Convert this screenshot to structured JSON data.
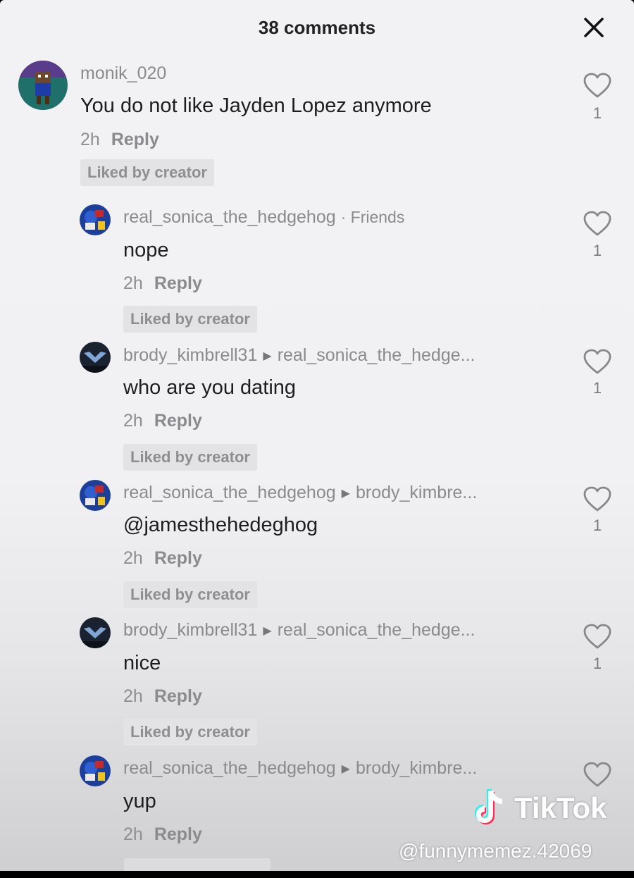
{
  "header": {
    "title": "38 comments"
  },
  "comments": [
    {
      "user": "monik_020",
      "target": "",
      "tag": "",
      "text": "You do not like Jayden Lopez anymore",
      "time": "2h",
      "reply": "Reply",
      "badge": "Liked by creator",
      "likes": "1"
    },
    {
      "user": "real_sonica_the_hedgehog",
      "target": "",
      "tag": "· Friends",
      "text": "nope",
      "time": "2h",
      "reply": "Reply",
      "badge": "Liked by creator",
      "likes": "1"
    },
    {
      "user": "brody_kimbrell31",
      "target": "real_sonica_the_hedge...",
      "tag": "",
      "text": "who are you dating",
      "time": "2h",
      "reply": "Reply",
      "badge": "Liked by creator",
      "likes": "1"
    },
    {
      "user": "real_sonica_the_hedgehog",
      "target": "brody_kimbre...",
      "tag": "",
      "text": "@jamesthehedeghog",
      "time": "2h",
      "reply": "Reply",
      "badge": "Liked by creator",
      "likes": "1"
    },
    {
      "user": "brody_kimbrell31",
      "target": "real_sonica_the_hedge...",
      "tag": "",
      "text": "nice",
      "time": "2h",
      "reply": "Reply",
      "badge": "Liked by creator",
      "likes": "1"
    },
    {
      "user": "real_sonica_the_hedgehog",
      "target": "brody_kimbre...",
      "tag": "",
      "text": "yup",
      "time": "2h",
      "reply": "Reply",
      "badge": "",
      "likes": ""
    }
  ],
  "watermark": {
    "brand": "TikTok",
    "handle": "@funnymemez.42069"
  }
}
